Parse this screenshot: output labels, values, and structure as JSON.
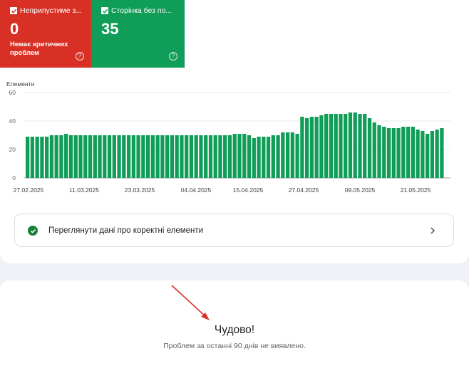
{
  "tiles": [
    {
      "label": "Неприпустиме з...",
      "value": "0",
      "subtitle": "Немає критичних проблем",
      "color": "#d93025"
    },
    {
      "label": "Сторінка без по...",
      "value": "35",
      "color": "#0f9d58"
    }
  ],
  "chart_data": {
    "type": "bar",
    "ylabel": "Елементи",
    "ylim": [
      0,
      60
    ],
    "yticks": [
      0,
      20,
      40,
      60
    ],
    "bar_color": "#0f9d58",
    "x_tick_labels": [
      "27.02.2025",
      "11.03.2025",
      "23.03.2025",
      "04.04.2025",
      "15.04.2025",
      "27.04.2025",
      "09.05.2025",
      "21.05.2025"
    ],
    "values": [
      29,
      29,
      29,
      29,
      29,
      30,
      30,
      30,
      31,
      30,
      30,
      30,
      30,
      30,
      30,
      30,
      30,
      30,
      30,
      30,
      30,
      30,
      30,
      30,
      30,
      30,
      30,
      30,
      30,
      30,
      30,
      30,
      30,
      30,
      30,
      30,
      30,
      30,
      30,
      30,
      30,
      30,
      30,
      31,
      31,
      31,
      30,
      28,
      29,
      29,
      29,
      30,
      30,
      32,
      32,
      32,
      31,
      43,
      42,
      43,
      43,
      44,
      45,
      45,
      45,
      45,
      45,
      46,
      46,
      45,
      45,
      42,
      39,
      37,
      36,
      35,
      35,
      35,
      36,
      36,
      36,
      34,
      33,
      31,
      33,
      34,
      35
    ]
  },
  "details_link": {
    "label": "Переглянути дані про коректні елементи",
    "check_color": "#188038"
  },
  "status": {
    "title": "Чудово!",
    "subtitle": "Проблем за останні 90 днів не виявлено."
  },
  "annotation": {
    "arrow_color": "#d93025"
  }
}
